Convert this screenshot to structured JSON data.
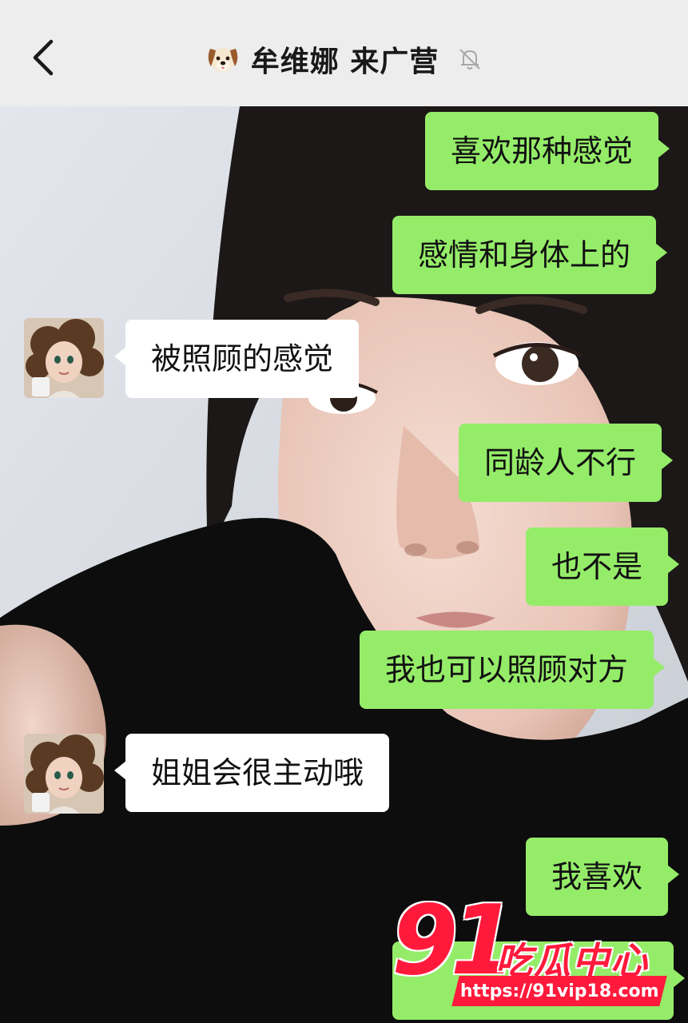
{
  "header": {
    "title": "牟维娜 来广营",
    "back_icon": "chevron-left-icon",
    "title_icon": "dog-face-icon",
    "mute_icon": "bell-muted-icon"
  },
  "colors": {
    "header_bg": "#ededed",
    "outgoing_bubble": "#95ec69",
    "incoming_bubble": "#ffffff",
    "watermark_red": "#ff1a3c"
  },
  "messages": [
    {
      "direction": "outgoing",
      "text": "喜欢那种感觉"
    },
    {
      "direction": "outgoing",
      "text": "感情和身体上的"
    },
    {
      "direction": "incoming",
      "text": "被照顾的感觉"
    },
    {
      "direction": "outgoing",
      "text": "同龄人不行"
    },
    {
      "direction": "outgoing",
      "text": "也不是"
    },
    {
      "direction": "outgoing",
      "text": "我也可以照顾对方"
    },
    {
      "direction": "incoming",
      "text": "姐姐会很主动哦"
    },
    {
      "direction": "outgoing",
      "text": "我喜欢"
    },
    {
      "direction": "outgoing",
      "text": ""
    }
  ],
  "watermark": {
    "number": "91",
    "name": "吃瓜中心",
    "url": "https://91vip18.com"
  }
}
